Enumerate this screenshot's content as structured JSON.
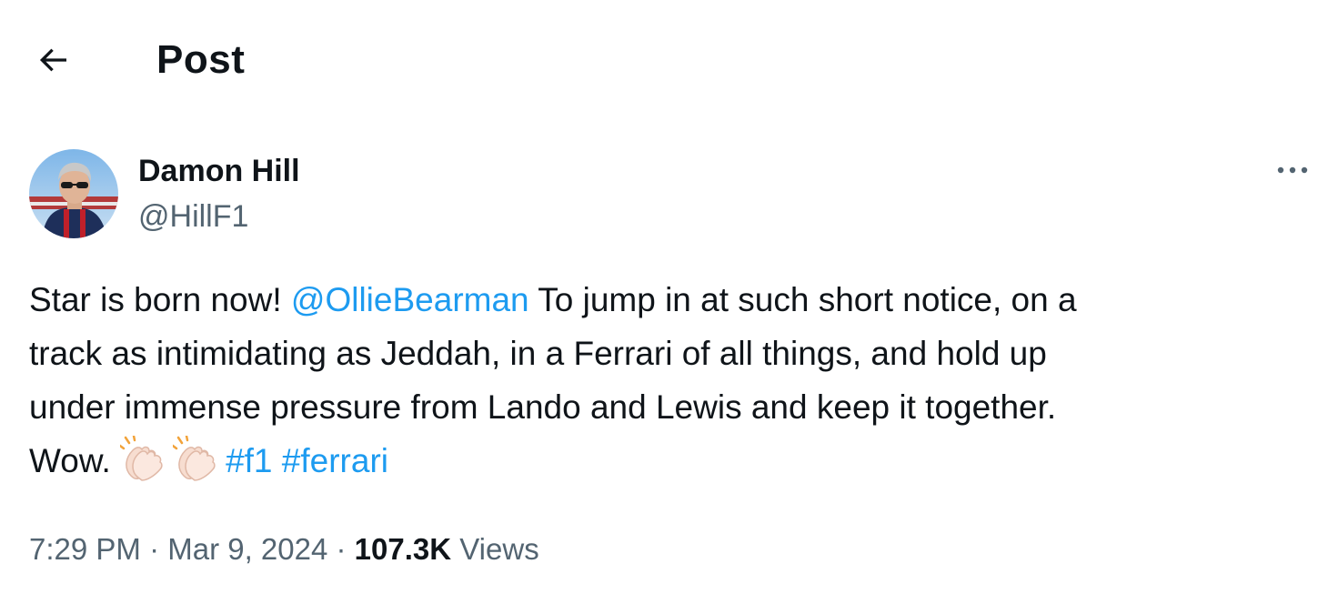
{
  "header": {
    "back_icon": "arrow-left-icon",
    "title": "Post"
  },
  "author": {
    "name": "Damon Hill",
    "handle": "@HillF1",
    "avatar_icon": "profile-photo"
  },
  "more_icon": "more-horizontal-icon",
  "tweet": {
    "line1_start": "Star is born now! ",
    "mention": "@OllieBearman",
    "line1_end": " To jump in at such short notice, on a",
    "line2": "track as intimidating as Jeddah, in a Ferrari of all things, and hold up",
    "line3": "under immense pressure from Lando and Lewis and keep it together.",
    "line4_start": "Wow. ",
    "emoji_icon": "clapping-hands-icon",
    "hashtag1": "#f1",
    "hashtag2": "#ferrari"
  },
  "meta": {
    "time": "7:29 PM",
    "separator": " · ",
    "date": "Mar 9, 2024",
    "views_count": "107.3K",
    "views_label": " Views"
  },
  "colors": {
    "text": "#0f1419",
    "secondary": "#536471",
    "link": "#1d9bf0"
  }
}
